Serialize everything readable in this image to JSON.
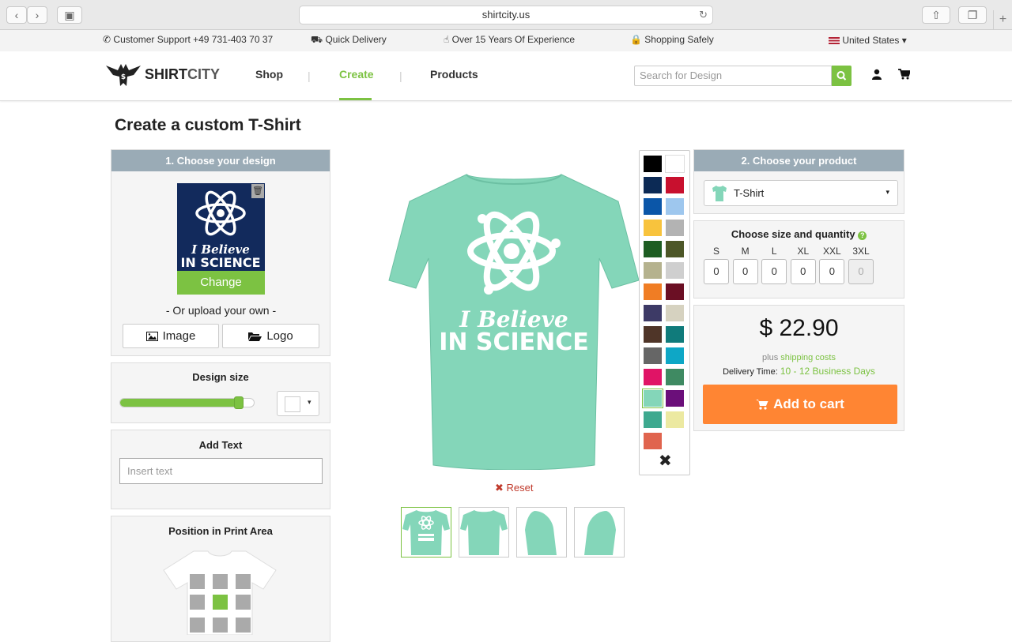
{
  "browser": {
    "url": "shirtcity.us",
    "plus": "+"
  },
  "infobar": {
    "support": "Customer Support +49 731-403 70 37",
    "delivery": "Quick Delivery",
    "experience": "Over 15 Years Of Experience",
    "safety": "Shopping Safely",
    "country": "United States"
  },
  "header": {
    "logo_a": "SHIRT",
    "logo_b": "CITY",
    "nav": [
      "Shop",
      "Create",
      "Products"
    ],
    "search_placeholder": "Search for Design"
  },
  "page": {
    "title": "Create a custom T-Shirt"
  },
  "design": {
    "head": "1. Choose your design",
    "change": "Change",
    "or_upload": "- Or upload your own -",
    "image_btn": "Image",
    "logo_btn": "Logo",
    "art_line1": "I Believe",
    "art_line2": "IN SCIENCE"
  },
  "design_size": {
    "title": "Design size",
    "level_percent": 90
  },
  "add_text": {
    "title": "Add Text",
    "placeholder": "Insert text"
  },
  "position": {
    "title": "Position in Print Area",
    "selected_cell": "center"
  },
  "preview": {
    "shirt_color": "#84d6b9",
    "art_line1": "I Believe",
    "art_line2": "IN SCIENCE",
    "reset": "Reset"
  },
  "swatch_colors": [
    "#000000",
    "#ffffff",
    "#0c2a55",
    "#c8102e",
    "#0b56a8",
    "#9ec7ee",
    "#f8c33d",
    "#b3b3b3",
    "#1d5d22",
    "#4d5728",
    "#b5b28e",
    "#cfcfcf",
    "#f07d24",
    "#6b0f24",
    "#3d3a66",
    "#d6d2c0",
    "#4f3528",
    "#107b7b",
    "#666666",
    "#0ea7c6",
    "#e01466",
    "#3f8a62",
    "#84d6b9",
    "#6b0f7a",
    "#3ea98f",
    "#ece9a1",
    "#e0644e"
  ],
  "product": {
    "head": "2. Choose your product",
    "selected": "T-Shirt",
    "size_title": "Choose size and quantity",
    "sizes": [
      "S",
      "M",
      "L",
      "XL",
      "XXL",
      "3XL"
    ],
    "qty": [
      "0",
      "0",
      "0",
      "0",
      "0",
      "0"
    ],
    "price": "$ 22.90",
    "ship_plus": "plus",
    "ship_link": "shipping costs",
    "delivery_label": "Delivery Time:",
    "delivery_value": "10 - 12 Business Days",
    "add_cart": "Add to cart"
  }
}
